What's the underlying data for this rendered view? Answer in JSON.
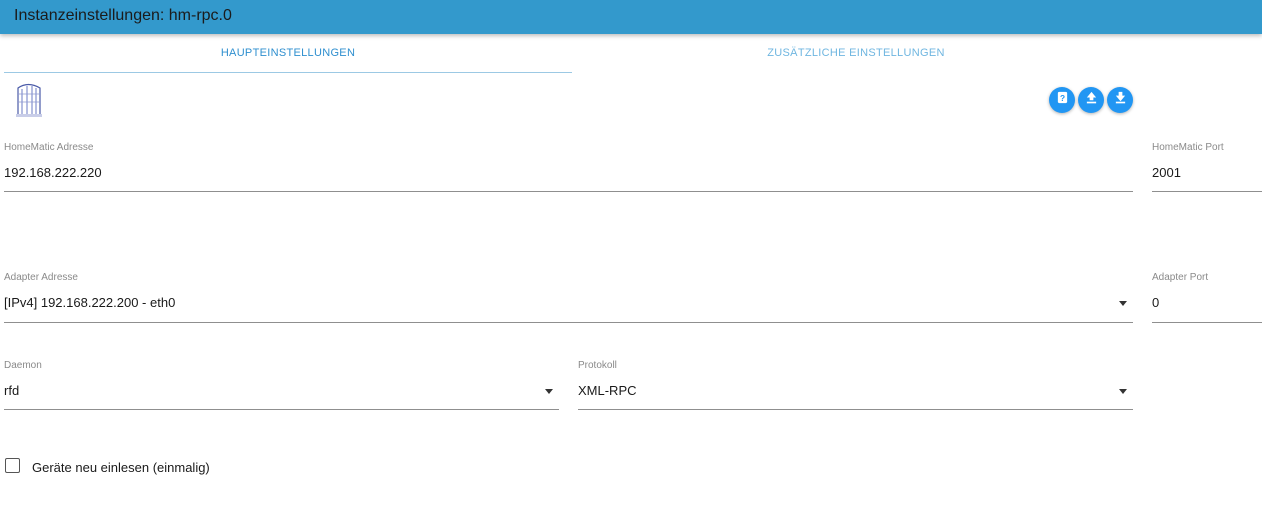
{
  "window": {
    "title": "Instanzeinstellungen: hm-rpc.0"
  },
  "tabs": [
    {
      "label": "HAUPTEINSTELLUNGEN",
      "active": true
    },
    {
      "label": "ZUSÄTZLICHE EINSTELLUNGEN",
      "active": false
    }
  ],
  "toolbar": {
    "buttons": [
      {
        "icon": "help-icon"
      },
      {
        "icon": "upload-icon"
      },
      {
        "icon": "download-icon"
      }
    ]
  },
  "fields": {
    "homematic_address": {
      "label": "HomeMatic Adresse",
      "value": "192.168.222.220"
    },
    "homematic_port": {
      "label": "HomeMatic Port",
      "value": "2001"
    },
    "adapter_address": {
      "label": "Adapter Adresse",
      "value": "[IPv4] 192.168.222.200 - eth0"
    },
    "adapter_port": {
      "label": "Adapter Port",
      "value": "0"
    },
    "daemon": {
      "label": "Daemon",
      "value": "rfd"
    },
    "protocol": {
      "label": "Protokoll",
      "value": "XML-RPC"
    }
  },
  "checkbox": {
    "label": "Geräte neu einlesen (einmalig)",
    "checked": false
  },
  "colors": {
    "accent": "#3399cc",
    "button": "#2196f3"
  }
}
